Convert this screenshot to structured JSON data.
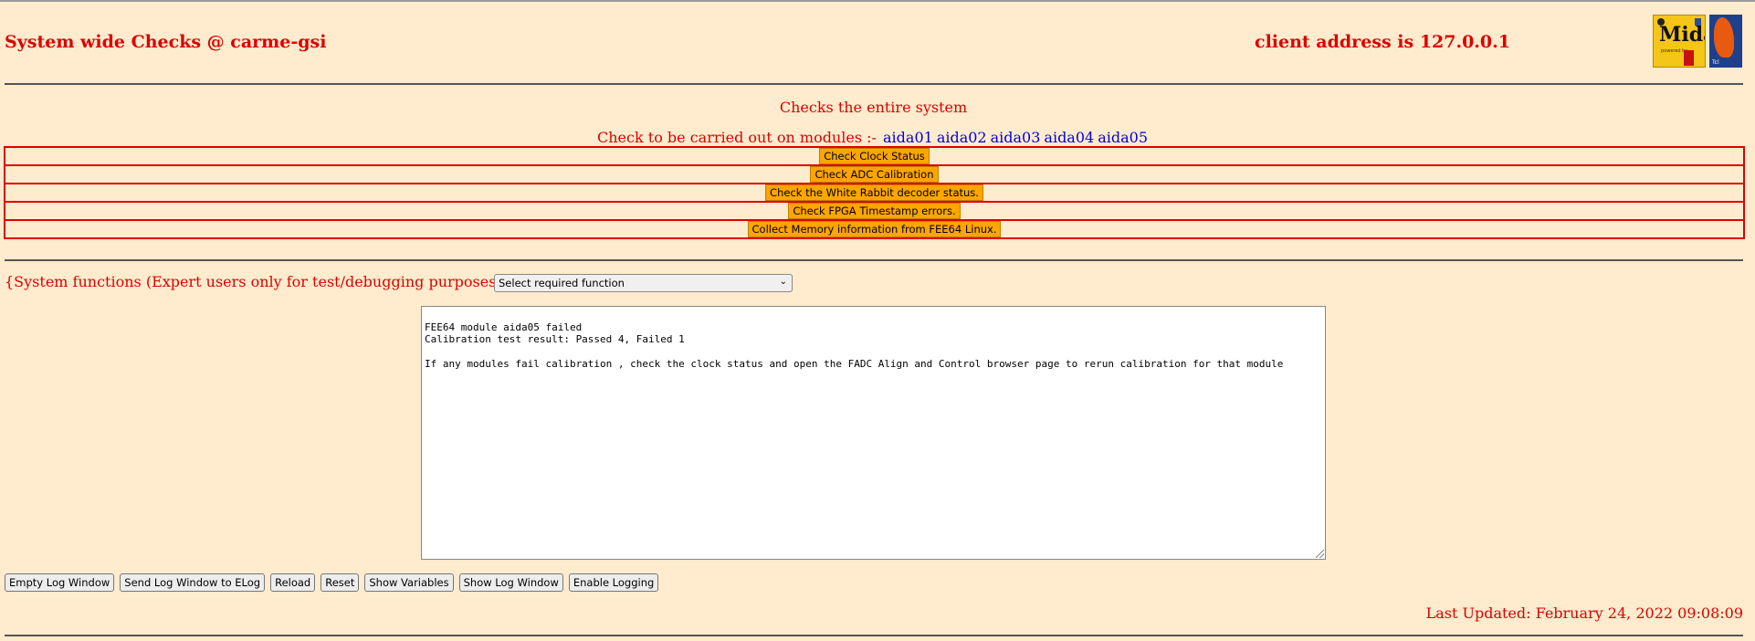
{
  "header": {
    "title": "System wide Checks @ carme-gsi",
    "client_address": "client address is 127.0.0.1",
    "logos": [
      "Midas",
      "Tcl"
    ]
  },
  "description": "Checks the entire system",
  "modules": {
    "label": "Check to be carried out on modules :-",
    "items": [
      "aida01",
      "aida02",
      "aida03",
      "aida04",
      "aida05"
    ]
  },
  "checks": [
    {
      "label": "Check Clock Status"
    },
    {
      "label": "Check ADC Calibration"
    },
    {
      "label": "Check the White Rabbit decoder status."
    },
    {
      "label": "Check FPGA Timestamp errors."
    },
    {
      "label": "Collect Memory information from FEE64 Linux."
    }
  ],
  "system_functions": {
    "label": "{System functions (Expert users only for test/debugging purposes!!!)  } {",
    "select_value": "Select required function"
  },
  "log": {
    "text": "FEE64 module aida05 failed\nCalibration test result: Passed 4, Failed 1\n\nIf any modules fail calibration , check the clock status and open the FADC Align and Control browser page to rerun calibration for that module"
  },
  "bottom_buttons": [
    {
      "label": "Empty Log Window"
    },
    {
      "label": "Send Log Window to ELog"
    },
    {
      "label": "Reload"
    },
    {
      "label": "Reset"
    },
    {
      "label": "Show Variables"
    },
    {
      "label": "Show Log Window"
    },
    {
      "label": "Enable Logging"
    }
  ],
  "last_updated": "Last Updated: February 24, 2022 09:08:09",
  "colors": {
    "background": "#ffebcd",
    "text_red": "#dd0000",
    "module_blue": "#0000dd",
    "check_button": "#ffa500"
  }
}
